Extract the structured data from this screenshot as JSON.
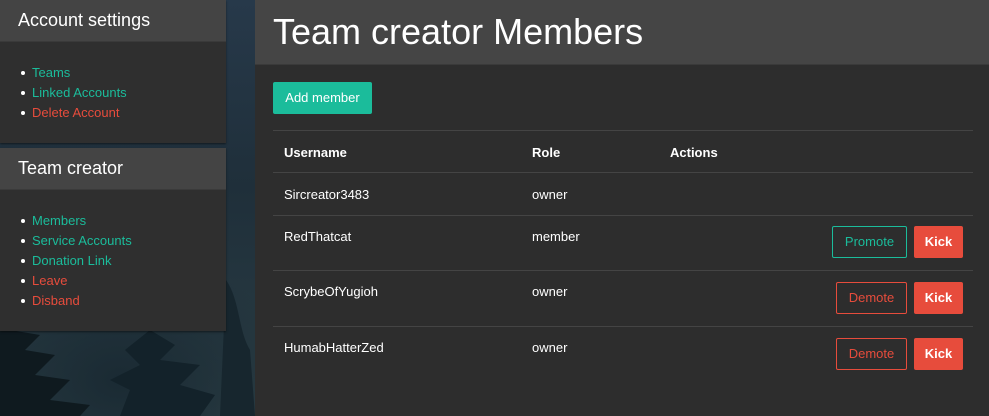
{
  "colors": {
    "accent_green": "#1bbc9b",
    "danger_red": "#e74c3c",
    "panel_bg": "#2f2f2f",
    "panel_header_bg": "#444444",
    "main_bg": "#2d2d2d"
  },
  "sidebar": {
    "account": {
      "title": "Account settings",
      "items": [
        {
          "label": "Teams",
          "color": "#1bbc9b"
        },
        {
          "label": "Linked Accounts",
          "color": "#1bbc9b"
        },
        {
          "label": "Delete Account",
          "color": "#e74c3c"
        }
      ]
    },
    "team": {
      "title": "Team creator",
      "items": [
        {
          "label": "Members",
          "color": "#1bbc9b"
        },
        {
          "label": "Service Accounts",
          "color": "#1bbc9b"
        },
        {
          "label": "Donation Link",
          "color": "#1bbc9b"
        },
        {
          "label": "Leave",
          "color": "#e74c3c"
        },
        {
          "label": "Disband",
          "color": "#e74c3c"
        }
      ]
    }
  },
  "main": {
    "title": "Team creator Members",
    "add_member_label": "Add member",
    "table": {
      "headers": {
        "username": "Username",
        "role": "Role",
        "actions": "Actions"
      },
      "rows": [
        {
          "username": "Sircreator3483",
          "role": "owner"
        },
        {
          "username": "RedThatcat",
          "role": "member",
          "role_action": "Promote",
          "kick": "Kick"
        },
        {
          "username": "ScrybeOfYugioh",
          "role": "owner",
          "role_action": "Demote",
          "kick": "Kick"
        },
        {
          "username": "HumabHatterZed",
          "role": "owner",
          "role_action": "Demote",
          "kick": "Kick"
        }
      ]
    }
  }
}
